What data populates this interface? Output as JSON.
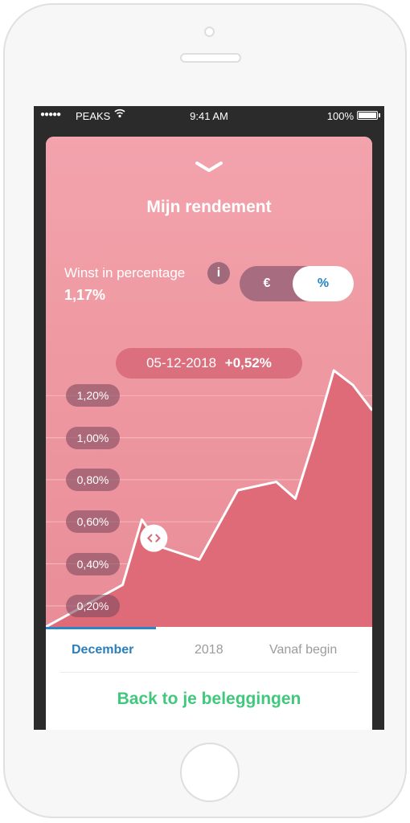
{
  "status_bar": {
    "carrier": "PEAKS",
    "time": "9:41 AM",
    "battery": "100%"
  },
  "header": {
    "title": "Mijn rendement",
    "chevron_icon": "chevron-down-icon"
  },
  "summary": {
    "label": "Winst in percentage",
    "value": "1,17%",
    "info_icon_text": "i"
  },
  "toggle": {
    "euro_label": "€",
    "percent_label": "%",
    "selected": "%"
  },
  "tooltip": {
    "date": "05-12-2018",
    "change": "+0,52%"
  },
  "chart_data": {
    "type": "area",
    "y_tick_labels": [
      "1,20%",
      "1,00%",
      "0,80%",
      "0,60%",
      "0,40%",
      "0,20%"
    ],
    "ylim": [
      0.1,
      1.4
    ],
    "xlim": [
      0,
      17
    ],
    "x": [
      0,
      4,
      5,
      6,
      8,
      10,
      12,
      13,
      14,
      15,
      16,
      17
    ],
    "y": [
      0.1,
      0.3,
      0.61,
      0.48,
      0.42,
      0.75,
      0.79,
      0.71,
      1.0,
      1.32,
      1.25,
      1.13
    ],
    "selected_index": 2,
    "colors": {
      "area": "#df6a78",
      "line": "#ffffff",
      "grid": "#f6b7bf"
    }
  },
  "tabs": [
    {
      "label": "December",
      "active": true
    },
    {
      "label": "2018",
      "active": false
    },
    {
      "label": "Vanaf begin",
      "active": false
    }
  ],
  "footer": {
    "back_label": "Back to je beleggingen"
  },
  "colors": {
    "accent_blue": "#2a7fba",
    "green": "#40c97d",
    "pink": "#ef9aa3"
  }
}
